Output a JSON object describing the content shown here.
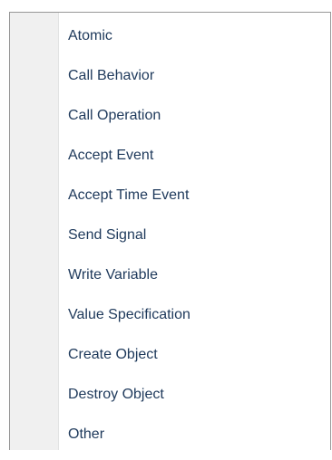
{
  "menu": {
    "items": [
      {
        "label": "Atomic"
      },
      {
        "label": "Call Behavior"
      },
      {
        "label": "Call Operation"
      },
      {
        "label": "Accept Event"
      },
      {
        "label": "Accept Time Event"
      },
      {
        "label": "Send Signal"
      },
      {
        "label": "Write Variable"
      },
      {
        "label": "Value Specification"
      },
      {
        "label": "Create Object"
      },
      {
        "label": "Destroy Object"
      },
      {
        "label": "Other"
      }
    ]
  }
}
